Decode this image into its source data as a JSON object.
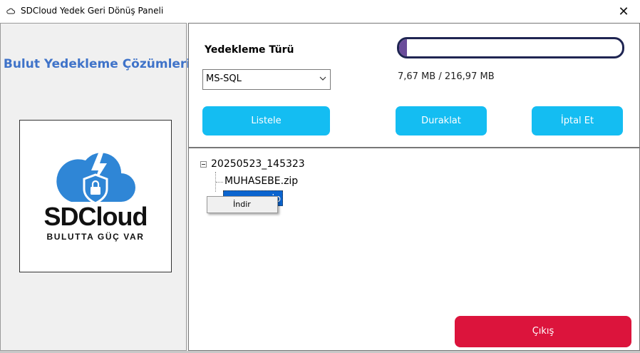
{
  "window": {
    "title": "SDCloud Yedek Geri Dönüş Paneli",
    "close_glyph": "✕"
  },
  "sidebar": {
    "brand_title": "Bulut Yedekleme Çözümleri",
    "logo_name": "SDCloud",
    "logo_tagline": "BULUTTA GÜÇ VAR",
    "logo_color": "#2f86d6"
  },
  "controls": {
    "type_label": "Yedekleme Türü",
    "type_value": "MS-SQL",
    "progress_fraction": 0.035,
    "size_text": "7,67 MB / 216,97 MB",
    "list_label": "Listele",
    "pause_label": "Duraklat",
    "cancel_label": "İptal Et",
    "accent_color": "#14bdf2"
  },
  "tree": {
    "root": "20250523_145323",
    "children": [
      "MUHASEBE.zip",
      "zip"
    ]
  },
  "context_menu": {
    "items": [
      "İndir"
    ]
  },
  "footer": {
    "exit_label": "Çıkış",
    "exit_color": "#dc143c"
  }
}
